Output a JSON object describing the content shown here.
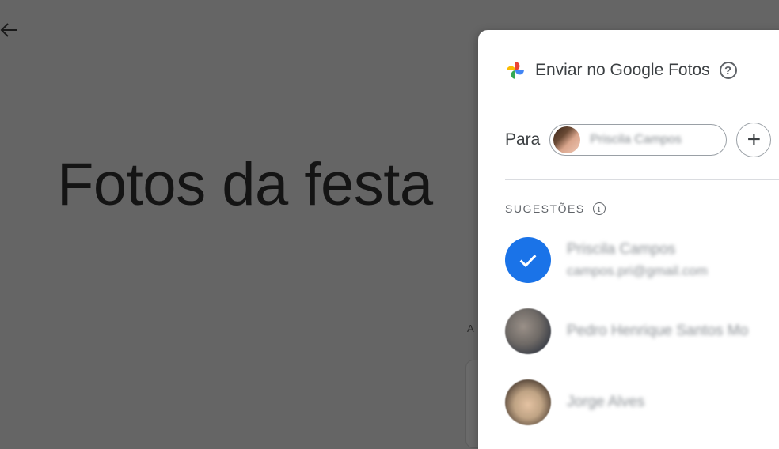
{
  "page": {
    "album_title": "Fotos da festa",
    "back_icon": "arrow-left-icon",
    "background_fragment": "A"
  },
  "dialog": {
    "title": "Enviar no Google Fotos",
    "logo_icon": "google-photos-pinwheel-icon",
    "help_icon": "help-circle-icon",
    "help_glyph": "?",
    "to_label": "Para",
    "recipient": {
      "name": "Priscila Campos"
    },
    "add_glyph": "+",
    "suggestions_title": "SUGESTÕES",
    "info_glyph": "i",
    "suggestions": [
      {
        "name": "Priscila Campos",
        "email": "campos.pri@gmail.com",
        "selected": true
      },
      {
        "name": "Pedro Henrique Santos Mo",
        "selected": false
      },
      {
        "name": "Jorge Alves",
        "selected": false
      }
    ],
    "colors": {
      "accent": "#1a73e8",
      "overlay": "#656565",
      "text": "#3c4043",
      "muted": "#5f6368"
    }
  }
}
